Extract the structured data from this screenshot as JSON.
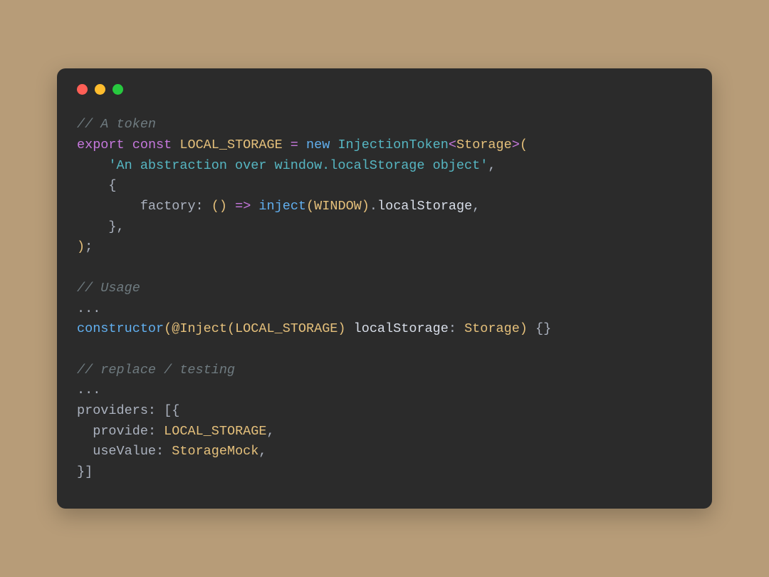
{
  "colors": {
    "background": "#b79c78",
    "editor_bg": "#2b2b2b",
    "red": "#ff5f56",
    "yellow": "#ffbd2e",
    "green": "#27c93f"
  },
  "code": {
    "l1_comment": "// A token",
    "l2_export": "export",
    "l2_const": "const",
    "l2_name": "LOCAL_STORAGE",
    "l2_eq": "=",
    "l2_new": "new",
    "l2_class": "InjectionToken",
    "l2_lt": "<",
    "l2_type": "Storage",
    "l2_gt": ">",
    "l2_open": "(",
    "l3_string": "'An abstraction over window.localStorage object'",
    "l3_comma": ",",
    "l4_obrace": "{",
    "l5_key": "factory",
    "l5_colon": ":",
    "l5_parens_open": "(",
    "l5_parens_close": ")",
    "l5_arrow": "=>",
    "l5_inject": "inject",
    "l5_iopen": "(",
    "l5_window": "WINDOW",
    "l5_iclose": ")",
    "l5_dot": ".",
    "l5_local": "localStorage",
    "l5_comma": ",",
    "l6_cbrace": "}",
    "l6_comma": ",",
    "l7_close": ")",
    "l7_semi": ";",
    "l9_comment": "// Usage",
    "l10_dots": "...",
    "l11_ctor": "constructor",
    "l11_open": "(",
    "l11_at": "@",
    "l11_inject": "Inject",
    "l11_iopen": "(",
    "l11_token": "LOCAL_STORAGE",
    "l11_iclose": ")",
    "l11_param": "localStorage",
    "l11_colon": ":",
    "l11_ptype": "Storage",
    "l11_close": ")",
    "l11_body": "{}",
    "l13_comment": "// replace / testing",
    "l14_dots": "...",
    "l15_providers": "providers",
    "l15_colon": ":",
    "l15_open": "[{",
    "l16_key": "provide",
    "l16_colon": ":",
    "l16_val": "LOCAL_STORAGE",
    "l16_comma": ",",
    "l17_key": "useValue",
    "l17_colon": ":",
    "l17_val": "StorageMock",
    "l17_comma": ",",
    "l18_close": "}]"
  }
}
